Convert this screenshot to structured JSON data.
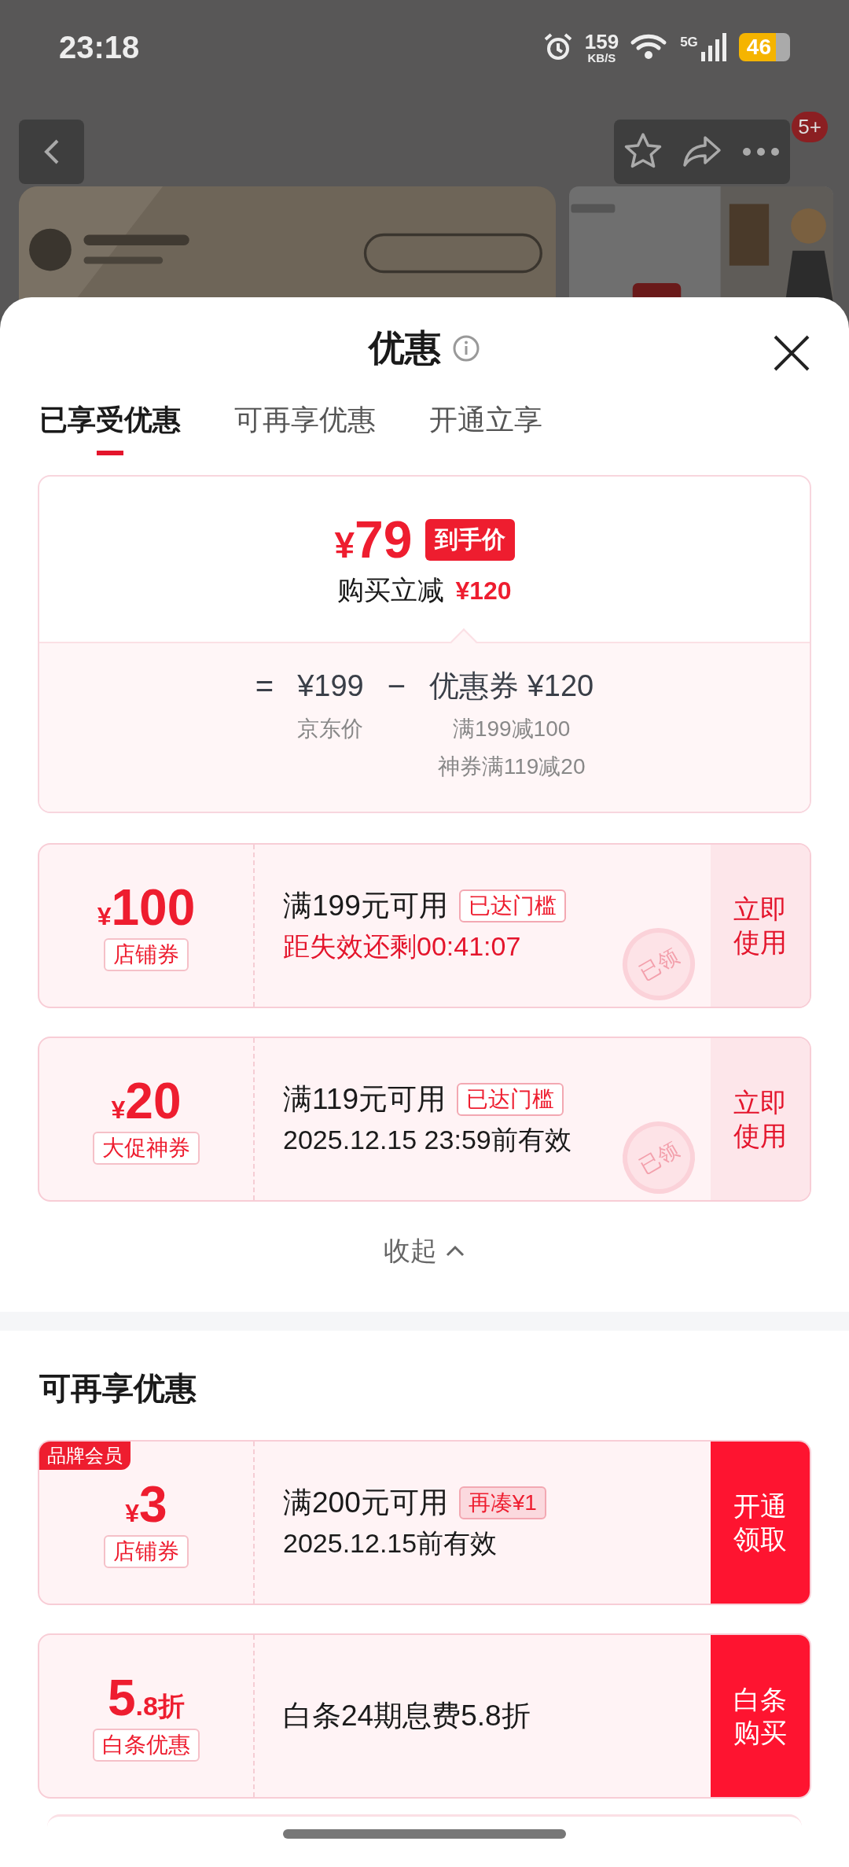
{
  "status_bar": {
    "time": "23:18",
    "net_speed": "159",
    "net_unit": "KB/S",
    "network": "5G",
    "battery": "46"
  },
  "nav": {
    "badge": "5+"
  },
  "sheet": {
    "title": "优惠",
    "tabs": [
      {
        "label": "已享受优惠",
        "selected": true
      },
      {
        "label": "可再享优惠",
        "selected": false
      },
      {
        "label": "开通立享",
        "selected": false
      }
    ]
  },
  "summary": {
    "currency": "¥",
    "final_price": "79",
    "final_tag": "到手价",
    "saving_label": "购买立减",
    "saving_amount": "¥120",
    "equals": "=",
    "base_price": "¥199",
    "base_label": "京东价",
    "minus": "−",
    "discount_label": "优惠券 ¥120",
    "discount_details": [
      "满199减100",
      "神券满119减20"
    ]
  },
  "coupons": [
    {
      "kind": "amount",
      "currency": "¥",
      "amount": "100",
      "type_label": "店铺券",
      "condition": "满199元可用",
      "tag": {
        "text": "已达门槛",
        "kind": "reached"
      },
      "note": "距失效还剩00:41:07",
      "note_urgent": true,
      "action": "立即使用",
      "action_highlighted": false,
      "stamp": "已领"
    },
    {
      "kind": "amount",
      "currency": "¥",
      "amount": "20",
      "type_label": "大促神券",
      "condition": "满119元可用",
      "tag": {
        "text": "已达门槛",
        "kind": "reached"
      },
      "note": "2025.12.15 23:59前有效",
      "note_urgent": false,
      "action": "立即使用",
      "action_highlighted": false,
      "stamp": "已领"
    }
  ],
  "collapse": "收起",
  "more": {
    "title": "可再享优惠",
    "coupons": [
      {
        "kind": "amount",
        "member_badge": "品牌会员",
        "currency": "¥",
        "amount": "3",
        "type_label": "店铺券",
        "condition": "满200元可用",
        "tag": {
          "text": "再凑¥1",
          "kind": "short"
        },
        "note": "2025.12.15前有效",
        "note_urgent": false,
        "action": "开通领取",
        "action_highlighted": true
      },
      {
        "kind": "discount",
        "amount": "5",
        "suffix": ".8折",
        "type_label": "白条优惠",
        "condition": "白条24期息费5.8折",
        "action": "白条购买",
        "action_highlighted": true
      }
    ]
  }
}
